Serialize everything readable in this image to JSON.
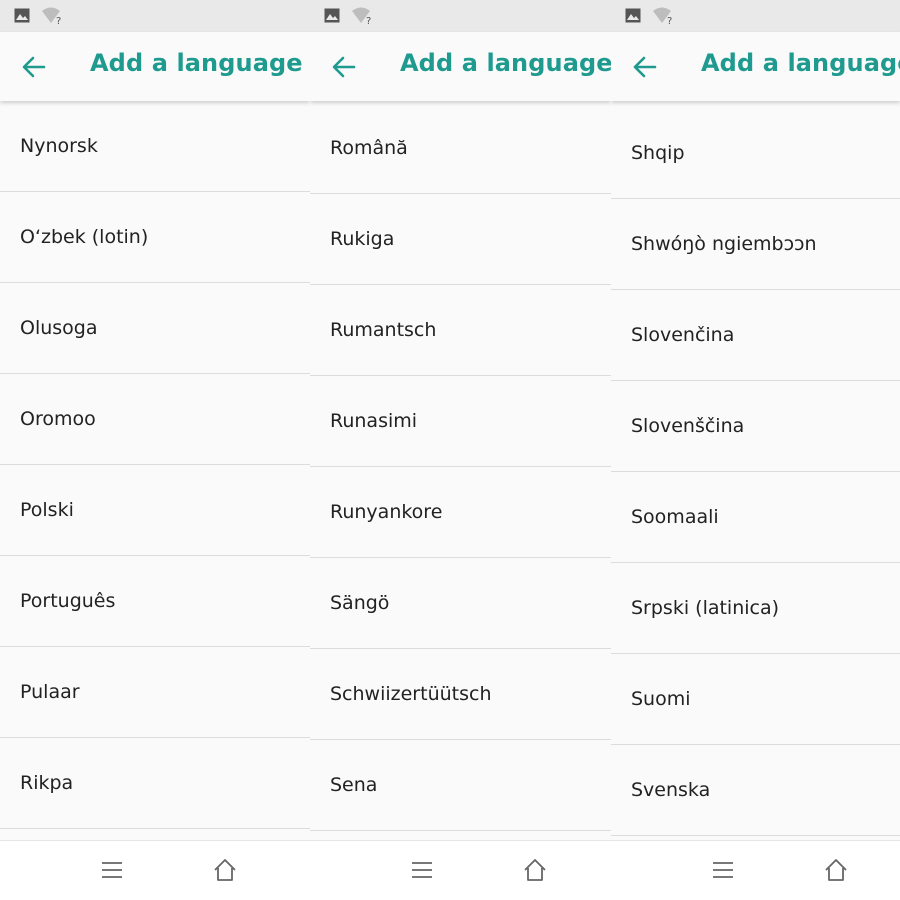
{
  "theme": {
    "accent": "#1e9a8e",
    "text": "#222222",
    "divider": "#dcdcdc"
  },
  "icons": {
    "status": [
      "image-icon",
      "wifi-question-icon"
    ],
    "appbar": "back-arrow-icon",
    "navbar": [
      "menu-icon",
      "home-icon"
    ]
  },
  "panels": [
    {
      "title": "Add a language",
      "items": [
        "Nynorsk",
        "O‘zbek (lotin)",
        "Olusoga",
        "Oromoo",
        "Polski",
        "Português",
        "Pulaar",
        "Rikpa"
      ]
    },
    {
      "title": "Add a language",
      "items": [
        "Română",
        "Rukiga",
        "Rumantsch",
        "Runasimi",
        "Runyankore",
        "Sängö",
        "Schwiizertüütsch",
        "Sena"
      ]
    },
    {
      "title": "Add a language",
      "items": [
        "Shqip",
        "Shwóŋò ngiembɔɔn",
        "Slovenčina",
        "Slovenščina",
        "Soomaali",
        "Srpski (latinica)",
        "Suomi",
        "Svenska"
      ]
    }
  ]
}
